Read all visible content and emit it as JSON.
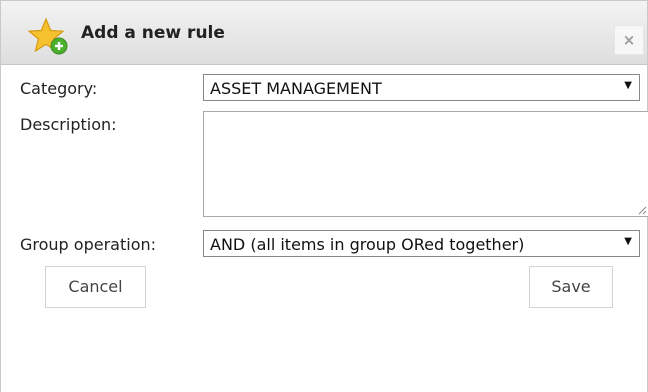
{
  "dialog": {
    "title": "Add a new rule",
    "close_label": "×"
  },
  "form": {
    "category_label": "Category:",
    "category_value": "ASSET MANAGEMENT",
    "description_label": "Description:",
    "description_value": "",
    "group_operation_label": "Group operation:",
    "group_operation_value": "AND (all items in group ORed together)"
  },
  "buttons": {
    "cancel_label": "Cancel",
    "save_label": "Save"
  },
  "icons": {
    "title_icon": "star-add-icon",
    "dropdown_icon": "caret-down-icon"
  },
  "colors": {
    "star": "#f5c12e",
    "plus": "#4caf2e"
  }
}
